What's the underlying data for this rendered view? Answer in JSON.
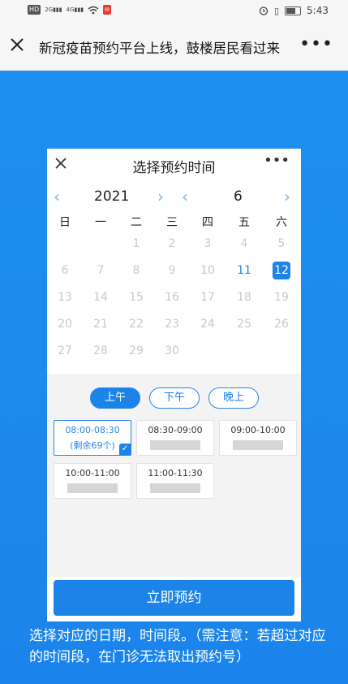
{
  "status_bar": {
    "left_chips": [
      "HD",
      "2G",
      "4G"
    ],
    "time": "5:43"
  },
  "title_bar": {
    "title": "新冠疫苗预约平台上线，鼓楼居民看过来",
    "more": "•••"
  },
  "phone": {
    "header_title": "选择预约时间",
    "more": "•••",
    "year": "2021",
    "month": "6",
    "weekdays": [
      "日",
      "一",
      "二",
      "三",
      "四",
      "五",
      "六"
    ],
    "days": [
      "1",
      "2",
      "3",
      "4",
      "5",
      "6",
      "7",
      "8",
      "9",
      "10",
      "11",
      "12",
      "13",
      "14",
      "15",
      "16",
      "17",
      "18",
      "19",
      "20",
      "21",
      "22",
      "23",
      "24",
      "25",
      "26",
      "27",
      "28",
      "29",
      "30"
    ],
    "available_days": [
      "11",
      "12"
    ],
    "selected_day": "12",
    "periods": [
      "上午",
      "下午",
      "晚上"
    ],
    "active_period": "上午",
    "slots": [
      {
        "time": "08:00-08:30",
        "remaining": "(剩余69个)",
        "selected": true
      },
      {
        "time": "08:30-09:00",
        "selected": false
      },
      {
        "time": "09:00-10:00",
        "selected": false
      },
      {
        "time": "10:00-11:00",
        "selected": false
      },
      {
        "time": "11:00-11:30",
        "selected": false
      }
    ],
    "book_button": "立即预约"
  },
  "caption": "选择对应的日期，时间段。（需注意：若超过对应的时间段，在门诊无法取出预约号）",
  "colors": {
    "accent": "#1c84e8",
    "background_blue": "#1e8ff0"
  }
}
